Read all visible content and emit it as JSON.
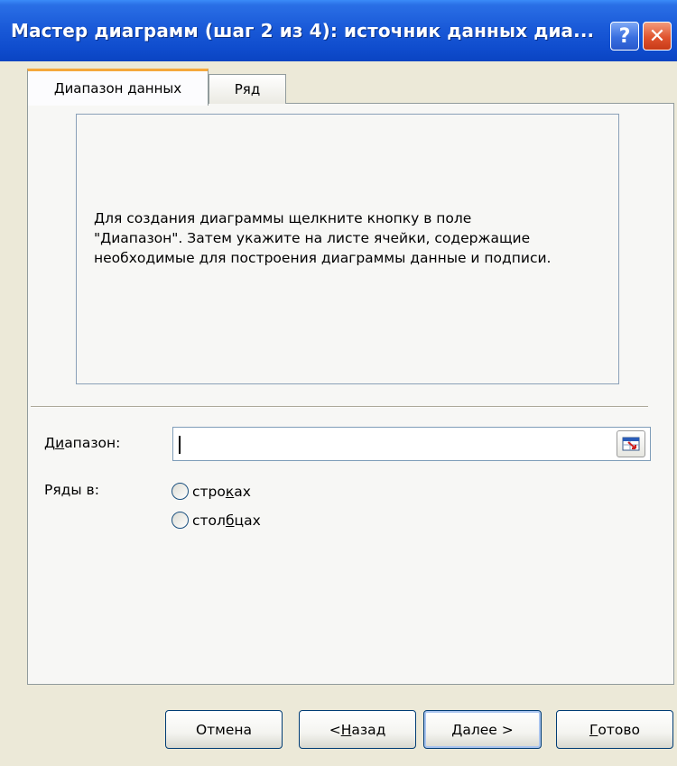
{
  "window": {
    "title": "Мастер диаграмм (шаг 2 из 4): источник данных диа..."
  },
  "titlebar_buttons": {
    "help": "?",
    "close": "✕"
  },
  "tabs": [
    {
      "label": "Диапазон данных",
      "active": true
    },
    {
      "label": "Ряд",
      "active": false
    }
  ],
  "preview": {
    "text": "Для создания диаграммы щелкните кнопку в поле\n\"Диапазон\". Затем укажите на листе ячейки, содержащие\nнеобходимые для построения диаграммы данные и подписи."
  },
  "form": {
    "range_label": {
      "pre": "Д",
      "accel": "и",
      "post": "апазон:"
    },
    "range_value": "",
    "series_label": "Ряды в:",
    "options": [
      {
        "pre": "стро",
        "accel": "к",
        "post": "ах",
        "selected": false
      },
      {
        "pre": "стол",
        "accel": "б",
        "post": "цах",
        "selected": false
      }
    ]
  },
  "buttons": {
    "cancel": "Отмена",
    "back": {
      "pre": "< ",
      "accel": "Н",
      "post": "азад"
    },
    "next": {
      "accel": "Д",
      "post": "алее >"
    },
    "finish": {
      "accel": "Г",
      "post": "отово"
    }
  },
  "colors": {
    "titlebar": "#0f4ccd",
    "active_tab_accent": "#f5a83c",
    "dialog_bg": "#ece9d8"
  }
}
